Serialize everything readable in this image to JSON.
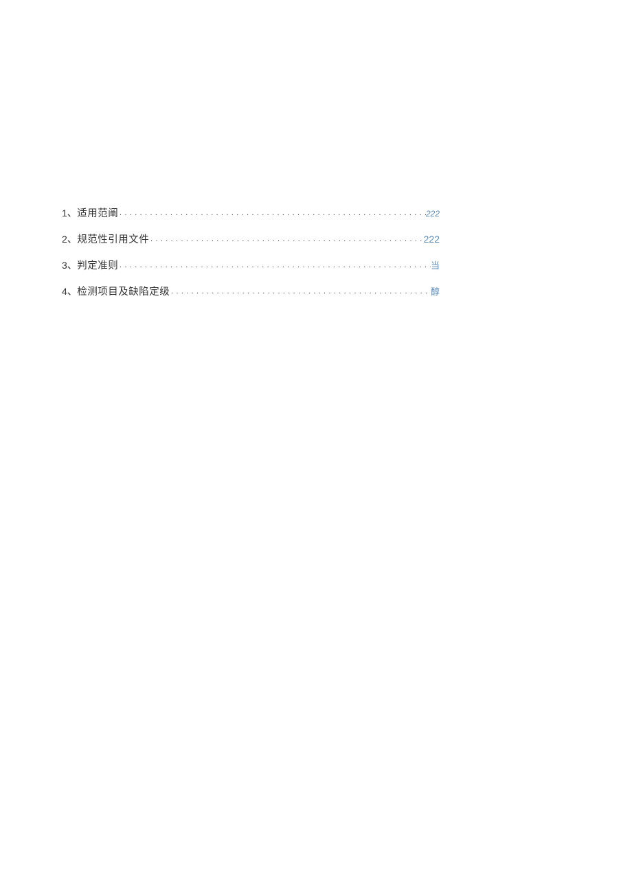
{
  "toc": {
    "entries": [
      {
        "number": "1",
        "sep": "、",
        "title": "适用范阐",
        "page": "222",
        "page_style": "italic"
      },
      {
        "number": "2",
        "sep": "、",
        "title": "规范性引用文件",
        "page": "222",
        "page_style": "normal"
      },
      {
        "number": "3",
        "sep": "、",
        "title": "判定准则",
        "page": "当",
        "page_style": "cjk"
      },
      {
        "number": "4",
        "sep": "、",
        "title": "检测项目及缺陷定级",
        "page": "醇",
        "page_style": "cjk"
      }
    ]
  }
}
